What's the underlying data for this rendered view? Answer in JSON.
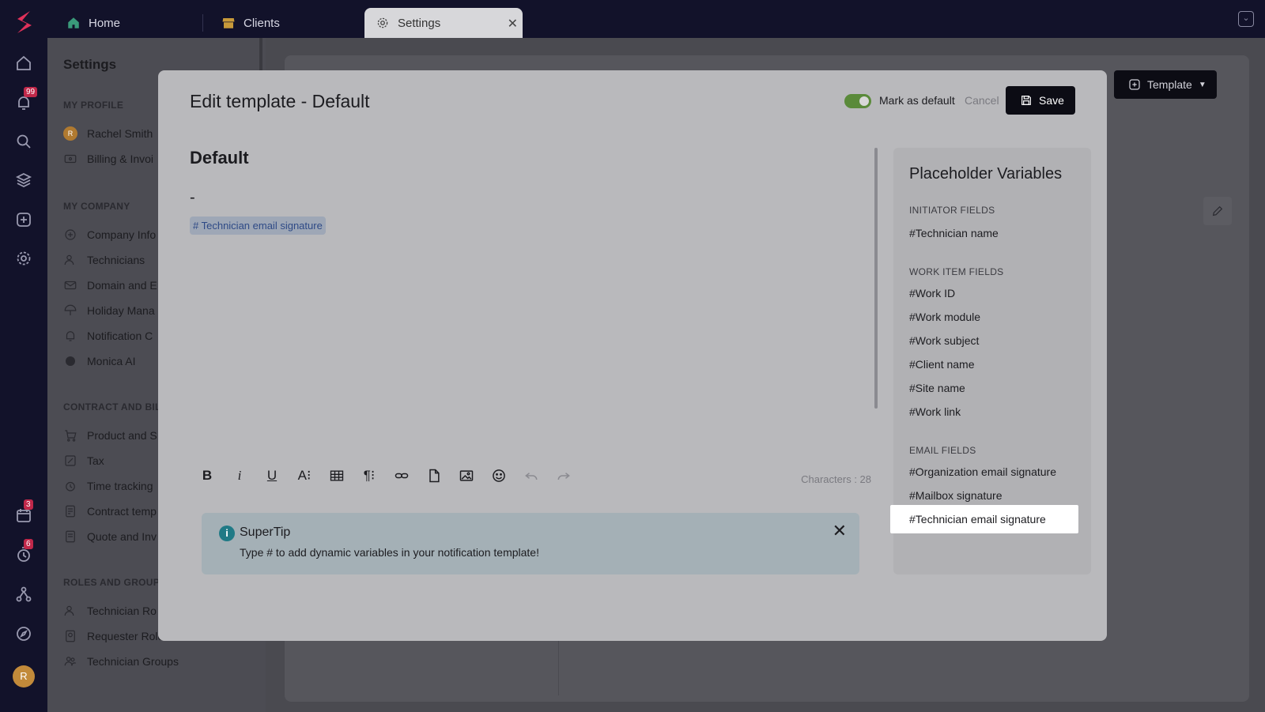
{
  "rail": {
    "notif_badge": "99",
    "calendar_badge": "3",
    "timer_badge": "6",
    "avatar_initial": "R"
  },
  "tabs": [
    {
      "label": "Home",
      "icon": "home-icon"
    },
    {
      "label": "Clients",
      "icon": "store-icon"
    },
    {
      "label": "Settings",
      "icon": "gear-icon",
      "active": true
    }
  ],
  "settings": {
    "title": "Settings",
    "sections": [
      {
        "label": "MY PROFILE",
        "items": [
          "Rachel Smith",
          "Billing & Invoi"
        ]
      },
      {
        "label": "MY COMPANY",
        "items": [
          "Company Info",
          "Technicians",
          "Domain and E",
          "Holiday Mana",
          "Notification C",
          "Monica AI"
        ]
      },
      {
        "label": "CONTRACT AND BIL",
        "items": [
          "Product and S",
          "Tax",
          "Time tracking",
          "Contract temp",
          "Quote and Inv"
        ]
      },
      {
        "label": "ROLES AND GROUP",
        "items": [
          "Technician Ro",
          "Requester Roles",
          "Technician Groups"
        ]
      }
    ]
  },
  "main": {
    "template_button": "Template"
  },
  "modal": {
    "title": "Edit template - Default",
    "mark_default_label": "Mark as default",
    "mark_default_on": true,
    "cancel_label": "Cancel",
    "save_label": "Save",
    "editor": {
      "name": "Default",
      "dash": "-",
      "tag": "# Technician email signature",
      "characters": "Characters : 28"
    },
    "tip": {
      "title": "SuperTip",
      "text": "Type # to add dynamic variables in your notification template!"
    },
    "placeholders": {
      "title": "Placeholder Variables",
      "initiator_label": "INITIATOR FIELDS",
      "initiator": [
        "#Technician name"
      ],
      "work_label": "WORK ITEM FIELDS",
      "work": [
        "#Work ID",
        "#Work module",
        "#Work subject",
        "#Client name",
        "#Site name",
        "#Work link"
      ],
      "email_label": "EMAIL FIELDS",
      "email": [
        "#Organization email signature",
        "#Mailbox signature",
        "#Technician email signature"
      ]
    }
  },
  "colors": {
    "brand": "#e0315a",
    "toggle_on": "#5a8a3a",
    "tip_icon": "#207a86"
  }
}
